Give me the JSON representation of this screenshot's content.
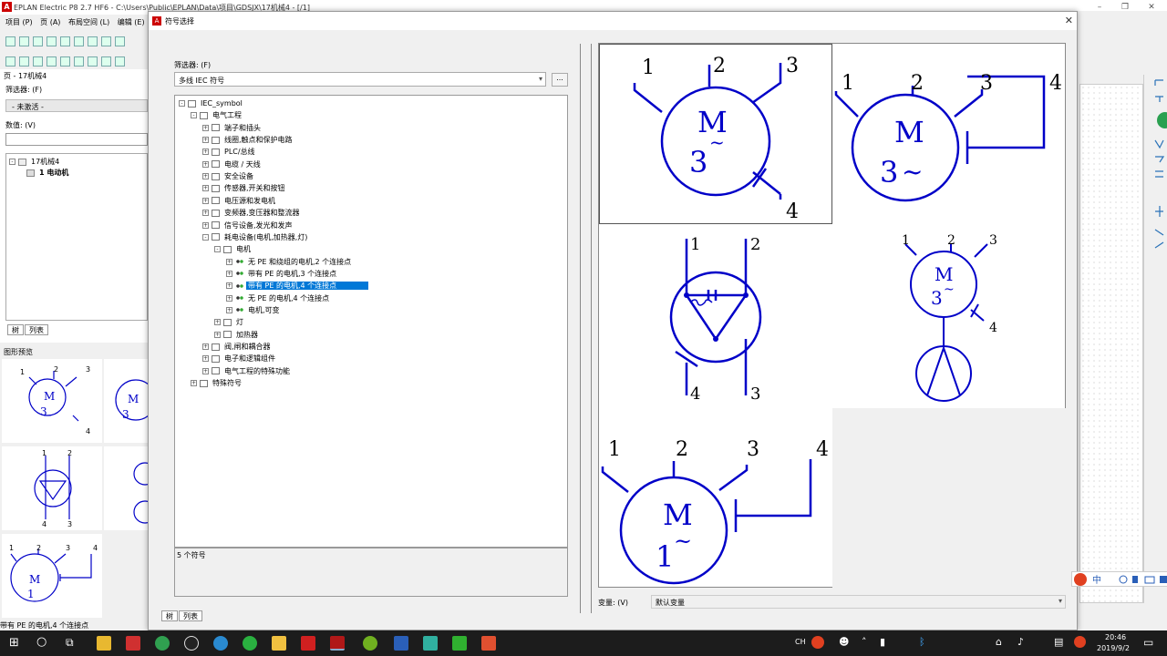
{
  "app": {
    "title": "EPLAN Electric P8 2.7 HF6 - C:\\Users\\Public\\EPLAN\\Data\\项目\\GDSJX\\17机械4 - [/1]",
    "menu": [
      "项目 (P)",
      "页 (A)",
      "布局空间 (L)",
      "编辑 (E)"
    ],
    "page_label": "页 - 17机械4",
    "filter_label": "筛选器: (F)",
    "filter_value": "- 未激活 -",
    "value_label": "数值: (V)",
    "nav_tree": [
      "17机械4",
      "1 电动机"
    ],
    "nav_tabs": [
      "树",
      "列表"
    ],
    "graphic_preview_label": "图形预览",
    "status_text": "带有 PE 的电机,4 个连接点"
  },
  "dialog": {
    "title": "符号选择",
    "filter_label": "筛选器: (F)",
    "filter_value": "多线 IEC 符号",
    "filter_more": "...",
    "tree": [
      {
        "label": "IEC_symbol",
        "level": 0,
        "exp": "-"
      },
      {
        "label": "电气工程",
        "level": 1,
        "exp": "-"
      },
      {
        "label": "端子和插头",
        "level": 2,
        "exp": "+"
      },
      {
        "label": "线圈,触点和保护电路",
        "level": 2,
        "exp": "+"
      },
      {
        "label": "PLC/总线",
        "level": 2,
        "exp": "+"
      },
      {
        "label": "电缆 / 天线",
        "level": 2,
        "exp": "+"
      },
      {
        "label": "安全设备",
        "level": 2,
        "exp": "+"
      },
      {
        "label": "传感器,开关和按钮",
        "level": 2,
        "exp": "+"
      },
      {
        "label": "电压源和发电机",
        "level": 2,
        "exp": "+"
      },
      {
        "label": "变频器,变压器和整流器",
        "level": 2,
        "exp": "+"
      },
      {
        "label": "信号设备,发光和发声",
        "level": 2,
        "exp": "+"
      },
      {
        "label": "耗电设备(电机,加热器,灯)",
        "level": 2,
        "exp": "-"
      },
      {
        "label": "电机",
        "level": 3,
        "exp": "-"
      },
      {
        "label": "无 PE 和绕组的电机,2 个连接点",
        "level": 4,
        "exp": "+"
      },
      {
        "label": "带有 PE 的电机,3 个连接点",
        "level": 4,
        "exp": "+"
      },
      {
        "label": "带有 PE 的电机,4 个连接点",
        "level": 4,
        "exp": "+",
        "selected": true
      },
      {
        "label": "无 PE 的电机,4 个连接点",
        "level": 4,
        "exp": "+"
      },
      {
        "label": "电机,可变",
        "level": 4,
        "exp": "+"
      },
      {
        "label": "灯",
        "level": 3,
        "exp": "+"
      },
      {
        "label": "加热器",
        "level": 3,
        "exp": "+"
      },
      {
        "label": "阀,闸和耦合器",
        "level": 2,
        "exp": "+"
      },
      {
        "label": "电子和逻辑组件",
        "level": 2,
        "exp": "+"
      },
      {
        "label": "电气工程的特殊功能",
        "level": 2,
        "exp": "+"
      },
      {
        "label": "特殊符号",
        "level": 1,
        "exp": "+"
      }
    ],
    "symbol_count": "5 个符号",
    "tabs": [
      "树",
      "列表"
    ],
    "variant_label": "变量: (V)",
    "variant_value": "默认变量",
    "symbols": [
      {
        "name": "motor-3-connection-pe",
        "letters": [
          "M",
          "3",
          "~"
        ],
        "terminals": [
          "1",
          "2",
          "3",
          "4"
        ]
      },
      {
        "name": "motor-4-connection-pe",
        "letters": [
          "M",
          "3",
          "~"
        ],
        "terminals": [
          "1",
          "2",
          "3",
          "4"
        ]
      },
      {
        "name": "motor-delta-winding",
        "letters": [],
        "terminals": [
          "1",
          "2",
          "3",
          "4"
        ]
      },
      {
        "name": "motor-with-fan",
        "letters": [
          "M",
          "3",
          "~"
        ],
        "terminals": [
          "1",
          "2",
          "3",
          "4"
        ]
      },
      {
        "name": "motor-single-phase-pe",
        "letters": [
          "M",
          "1",
          "~"
        ],
        "terminals": [
          "1",
          "2",
          "3",
          "4"
        ]
      }
    ],
    "ime_text": "中"
  },
  "taskbar": {
    "lang": "CH",
    "time": "20:46",
    "date": "2019/9/2"
  },
  "colors": {
    "symbol_blue": "#0000c8",
    "selection": "#0078d7"
  }
}
